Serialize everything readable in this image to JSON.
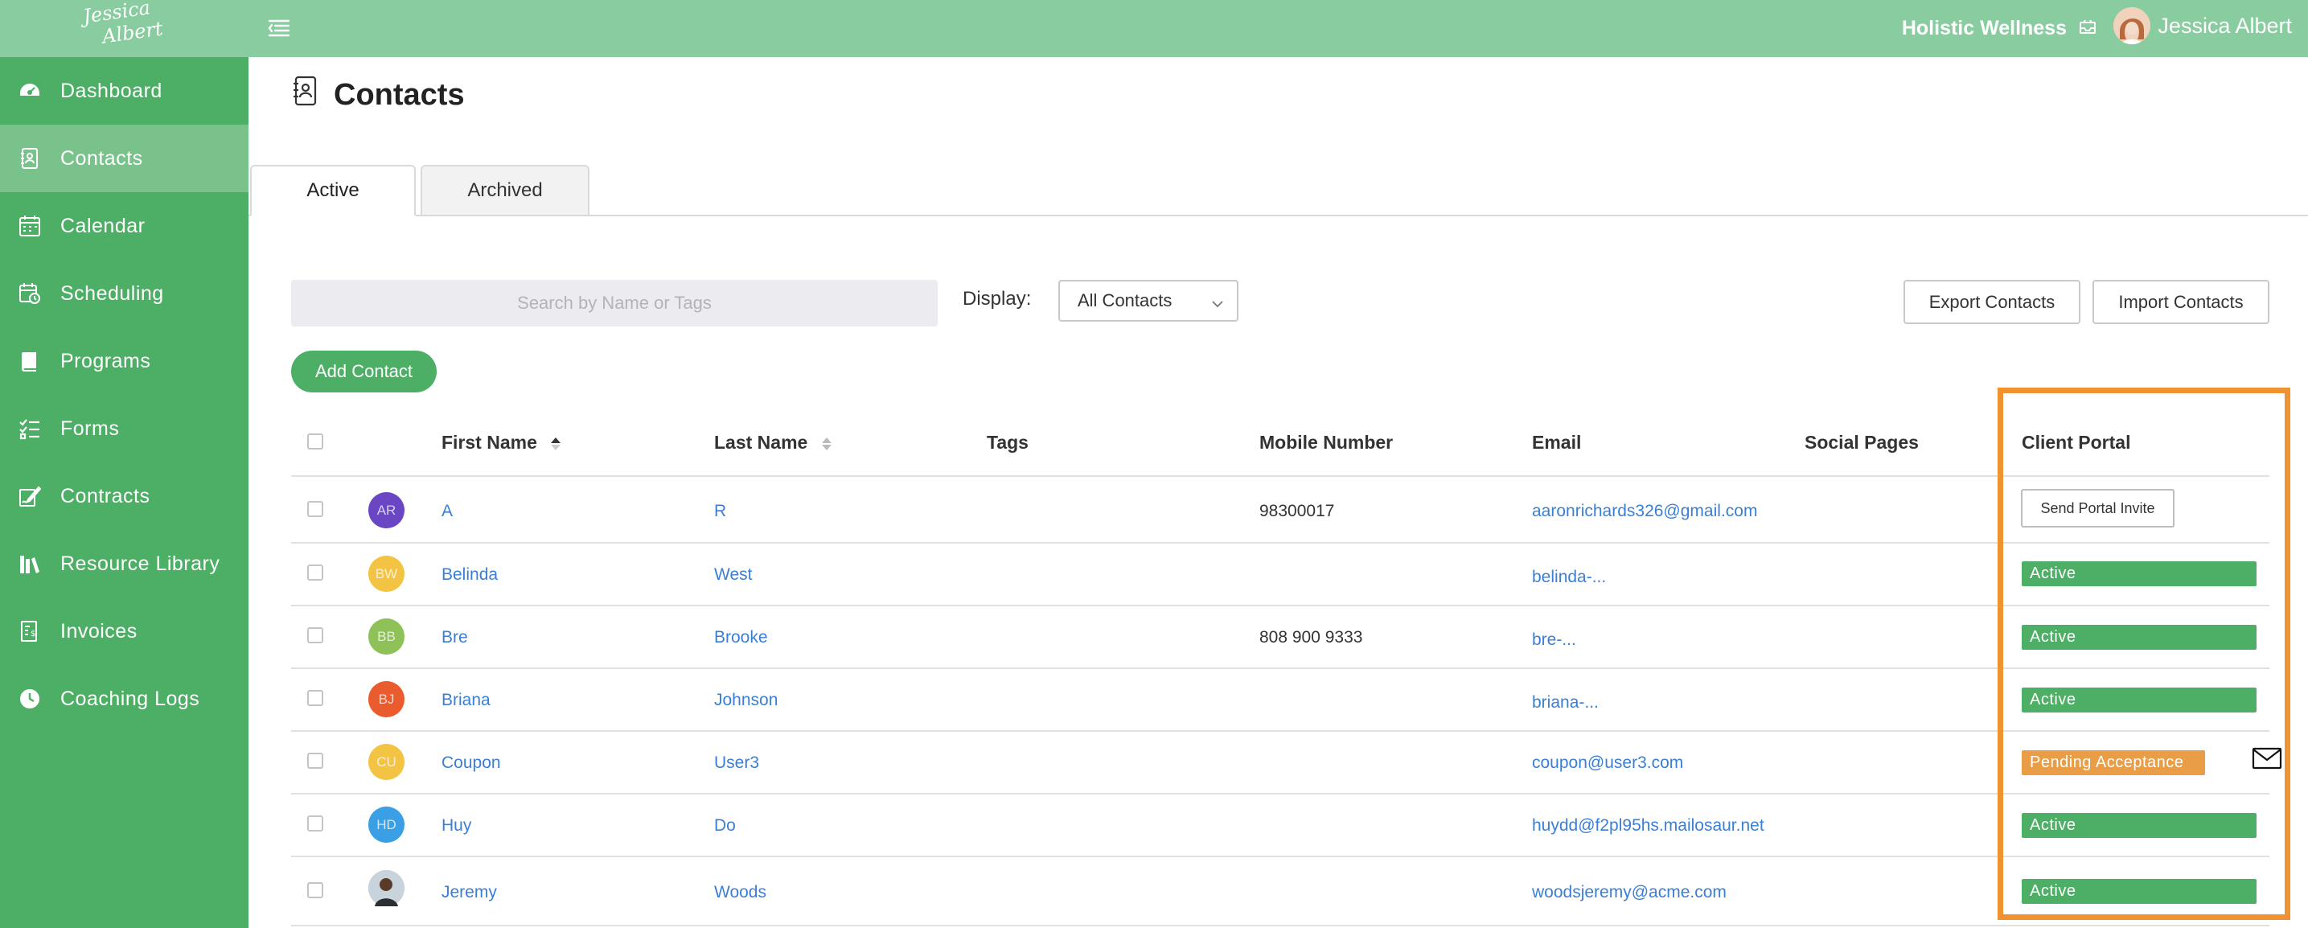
{
  "brand": {
    "logo_line1": "Jessica",
    "logo_line2": "Albert"
  },
  "topbar": {
    "org_name": "Holistic Wellness",
    "user_name": "Jessica Albert"
  },
  "sidebar": {
    "items": [
      {
        "label": "Dashboard",
        "icon": "dashboard-icon"
      },
      {
        "label": "Contacts",
        "icon": "contacts-icon",
        "active": true
      },
      {
        "label": "Calendar",
        "icon": "calendar-icon"
      },
      {
        "label": "Scheduling",
        "icon": "scheduling-icon"
      },
      {
        "label": "Programs",
        "icon": "book-icon"
      },
      {
        "label": "Forms",
        "icon": "checklist-icon"
      },
      {
        "label": "Contracts",
        "icon": "signature-icon"
      },
      {
        "label": "Resource Library",
        "icon": "library-icon"
      },
      {
        "label": "Invoices",
        "icon": "invoice-icon"
      },
      {
        "label": "Coaching Logs",
        "icon": "clock-icon"
      }
    ]
  },
  "page": {
    "title": "Contacts"
  },
  "tabs": [
    {
      "label": "Active",
      "active": true
    },
    {
      "label": "Archived",
      "active": false
    }
  ],
  "toolbar": {
    "search_placeholder": "Search by Name or Tags",
    "display_label": "Display:",
    "display_value": "All Contacts",
    "export_label": "Export Contacts",
    "import_label": "Import Contacts",
    "add_label": "Add Contact"
  },
  "table": {
    "headers": {
      "first_name": "First Name",
      "last_name": "Last Name",
      "tags": "Tags",
      "mobile": "Mobile Number",
      "email": "Email",
      "social": "Social Pages",
      "portal": "Client Portal"
    },
    "rows": [
      {
        "initials": "AR",
        "avatar_color": "#6a45c4",
        "first": "A",
        "last": "R",
        "mobile": "98300017",
        "email": "aaronrichards326@gmail.com",
        "portal_type": "button",
        "portal": "Send Portal Invite"
      },
      {
        "initials": "BW",
        "avatar_color": "#f3c344",
        "first": "Belinda",
        "last": "West",
        "mobile": "",
        "email": "belinda-...",
        "portal_type": "active",
        "portal": "Active"
      },
      {
        "initials": "BB",
        "avatar_color": "#8ec158",
        "first": "Bre",
        "last": "Brooke",
        "mobile": "808 900 9333",
        "email": "bre-...",
        "portal_type": "active",
        "portal": "Active"
      },
      {
        "initials": "BJ",
        "avatar_color": "#ea5b2d",
        "first": "Briana",
        "last": "Johnson",
        "mobile": "",
        "email": "briana-...",
        "portal_type": "active",
        "portal": "Active"
      },
      {
        "initials": "CU",
        "avatar_color": "#f3c344",
        "first": "Coupon",
        "last": "User3",
        "mobile": "",
        "email": "coupon@user3.com",
        "portal_type": "pending",
        "portal": "Pending Acceptance"
      },
      {
        "initials": "HD",
        "avatar_color": "#3b9fe6",
        "first": "Huy",
        "last": "Do",
        "mobile": "",
        "email": "huydd@f2pl95hs.mailosaur.net",
        "portal_type": "active",
        "portal": "Active"
      },
      {
        "initials": "",
        "avatar_color": "#b7c4cf",
        "first": "Jeremy",
        "last": "Woods",
        "mobile": "",
        "email": "woodsjeremy@acme.com",
        "portal_type": "active",
        "portal": "Active"
      }
    ]
  },
  "colors": {
    "topbar": "#88cc9f",
    "sidebar": "#4caf65",
    "sidebar_active": "#79c28c",
    "link": "#3a7fd5",
    "status_active": "#4caf65",
    "status_pending": "#e99d46",
    "highlight": "#f0922f"
  }
}
